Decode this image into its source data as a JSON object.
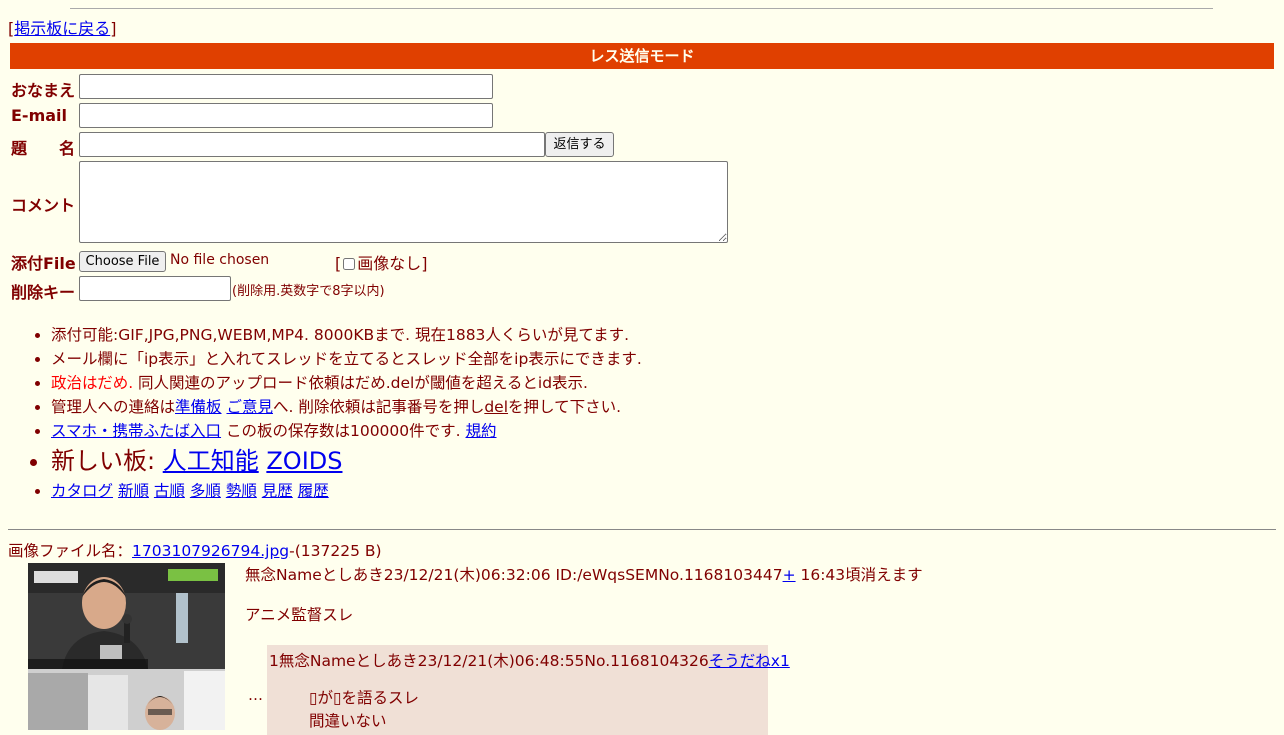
{
  "nav": {
    "bracket_open": "[",
    "back_link": "掲示板に戻る",
    "bracket_close": "]"
  },
  "form": {
    "mode_title": "レス送信モード",
    "name_label": "おなまえ",
    "email_label": "E-mail",
    "subject_label": "題　　名",
    "comment_label": "コメント",
    "file_label": "添付File",
    "delkey_label": "削除キー",
    "name_value": "",
    "email_value": "",
    "subject_value": "",
    "comment_value": "",
    "submit_label": "返信する",
    "choose_file_label": "Choose File",
    "no_file_text": "No file chosen",
    "noimage_open": "[",
    "noimage_label": "画像なし",
    "noimage_close": "]",
    "noimage_checked": false,
    "delkey_value": "",
    "delkey_note": "(削除用.英数字で8字以内)"
  },
  "rules": {
    "line1": "添付可能:GIF,JPG,PNG,WEBM,MP4. 8000KBまで. 現在1883人くらいが見てます.",
    "line2": "メール欄に「ip表示」と入れてスレッドを立てるとスレッド全部をip表示にできます.",
    "line3_red": "政治はだめ.",
    "line3_rest": " 同人関連のアップロード依頼はだめ.delが閾値を超えるとid表示.",
    "line4_prefix": "管理人への連絡は",
    "line4_link1": "準備板",
    "line4_sep": " ",
    "line4_link2": "ご意見",
    "line4_mid": "へ. 削除依頼は記事番号を押し",
    "line4_del": "del",
    "line4_suffix": "を押して下さい.",
    "line5_link": "スマホ・携帯ふたば入口",
    "line5_text": " この板の保存数は100000件です. ",
    "line5_link2": "規約",
    "new_boards_label": "新しい板: ",
    "new_board1": "人工知能",
    "new_board2": "ZOIDS",
    "sort_links": [
      "カタログ",
      "新順",
      "古順",
      "多順",
      "勢順",
      "見歴",
      "履歴"
    ]
  },
  "thread": {
    "file_label": "画像ファイル名：",
    "file_name": "1703107926794.jpg",
    "file_size": "-(137225 B)",
    "header": "無念Nameとしあき23/12/21(木)06:32:06 ID:/eWqsSEMNo.1168103447",
    "plus_link": "+",
    "expire": " 16:43頃消えます",
    "subject": "アニメ監督スレ",
    "ellipsis": "…",
    "reply": {
      "header": "1無念Nameとしあき23/12/21(木)06:48:55No.1168104326",
      "soudane": "そうだねx1",
      "line1": "▯が▯を語るスレ",
      "line2": "間違いない"
    }
  },
  "colors": {
    "background": "#ffffee",
    "text": "#800000",
    "mode_bar": "#e04000",
    "reply_bg": "#f0e0d6",
    "link": "#0000ee",
    "warn": "#ff0000"
  }
}
